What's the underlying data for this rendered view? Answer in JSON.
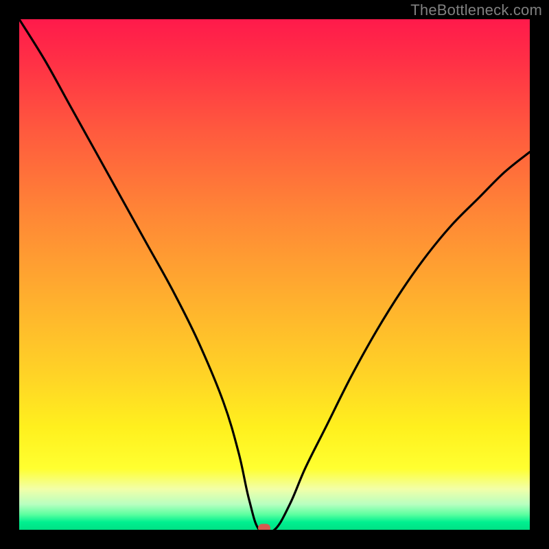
{
  "watermark": "TheBottleneck.com",
  "chart_data": {
    "type": "line",
    "title": "",
    "xlabel": "",
    "ylabel": "",
    "xlim": [
      0,
      100
    ],
    "ylim": [
      0,
      100
    ],
    "grid": false,
    "legend": false,
    "note": "x,y in percent of plot area; y=0 is bottom edge (green), y=100 is top edge (red). Single curve tracing bottleneck magnitude with a minimum near x≈47.",
    "series": [
      {
        "name": "bottleneck-curve",
        "x": [
          0,
          5,
          10,
          15,
          20,
          25,
          30,
          35,
          40,
          43,
          45,
          47,
          50,
          53,
          56,
          60,
          65,
          70,
          75,
          80,
          85,
          90,
          95,
          100
        ],
        "y": [
          100,
          92,
          83,
          74,
          65,
          56,
          47,
          37,
          25,
          15,
          6,
          0,
          0,
          5,
          12,
          20,
          30,
          39,
          47,
          54,
          60,
          65,
          70,
          74
        ]
      }
    ],
    "marker": {
      "x": 48,
      "y": 0,
      "name": "optimal-point"
    },
    "colors": {
      "curve": "#000000",
      "marker": "#d85a50",
      "gradient_top": "#ff1a4b",
      "gradient_bottom": "#00e085",
      "frame": "#000000"
    }
  }
}
